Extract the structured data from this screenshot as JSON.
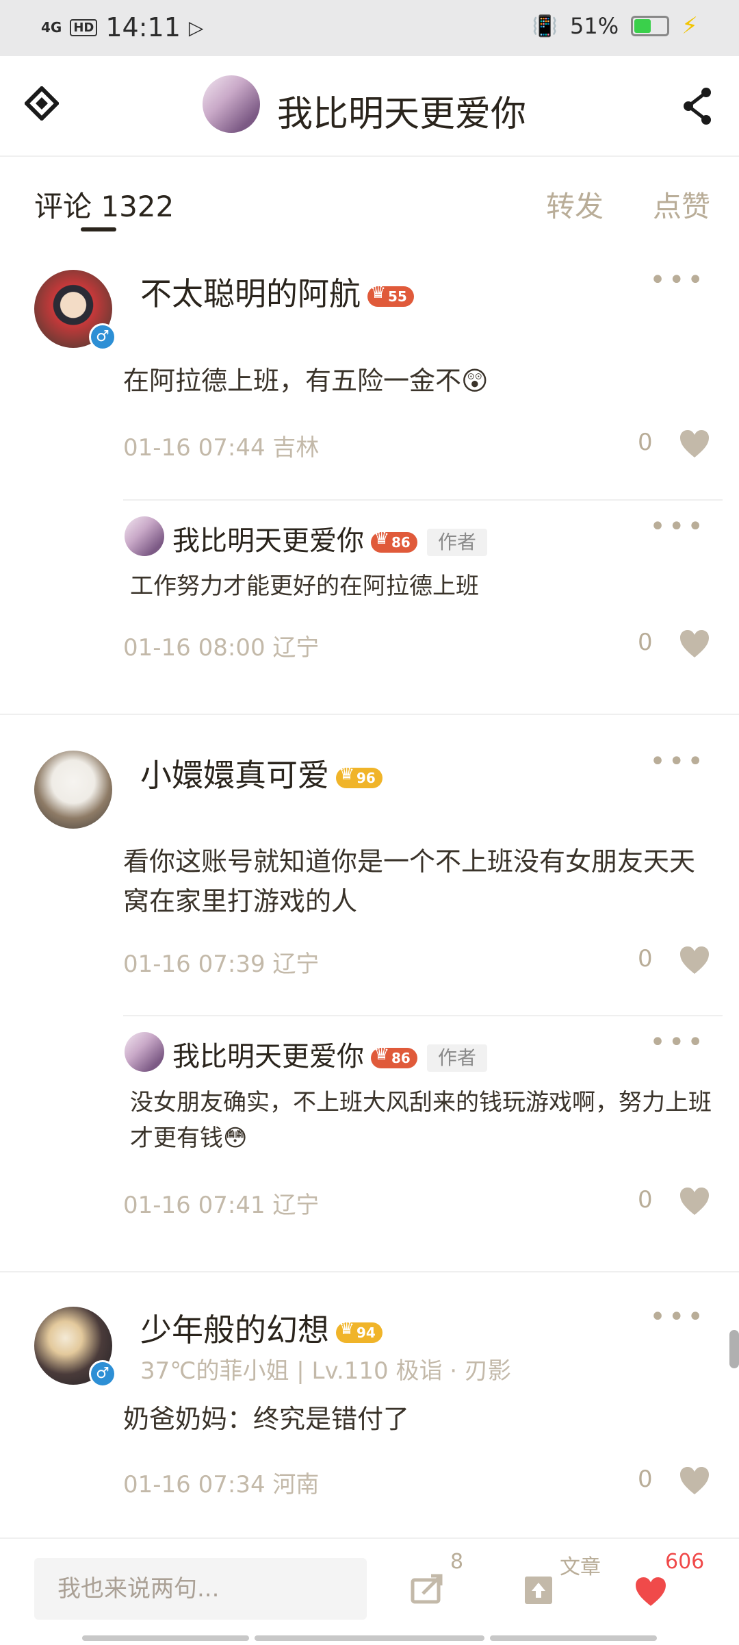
{
  "status_bar": {
    "network": "4G",
    "hd": "HD",
    "time": "14:11",
    "battery": "51%"
  },
  "header": {
    "title": "我比明天更爱你"
  },
  "tabs": {
    "comment": "评论 1322",
    "forward": "转发",
    "like": "点赞"
  },
  "comments": [
    {
      "user": "不太聪明的阿航",
      "level": "55",
      "text": "在阿拉德上班，有五险一金不😲",
      "time": "01-16 07:44",
      "location": "吉林",
      "likes": "0",
      "reply": {
        "user": "我比明天更爱你",
        "level": "86",
        "tag": "作者",
        "text": "工作努力才能更好的在阿拉德上班",
        "time": "01-16 08:00",
        "location": "辽宁",
        "likes": "0"
      }
    },
    {
      "user": "小嬛嬛真可爱",
      "level": "96",
      "text": "看你这账号就知道你是一个不上班没有女朋友天天窝在家里打游戏的人",
      "time": "01-16 07:39",
      "location": "辽宁",
      "likes": "0",
      "reply": {
        "user": "我比明天更爱你",
        "level": "86",
        "tag": "作者",
        "text": "没女朋友确实，不上班大风刮来的钱玩游戏啊，努力上班才更有钱😳",
        "time": "01-16 07:41",
        "location": "辽宁",
        "likes": "0"
      }
    },
    {
      "user": "少年般的幻想",
      "level": "94",
      "subline": "37℃的菲小姐 | Lv.110 极诣 · 刃影",
      "text": "奶爸奶妈：终究是错付了",
      "time": "01-16 07:34",
      "location": "河南",
      "likes": "0"
    }
  ],
  "bottom_bar": {
    "placeholder": "我也来说两句...",
    "share_count": "8",
    "article_label": "文章",
    "like_count": "606"
  }
}
